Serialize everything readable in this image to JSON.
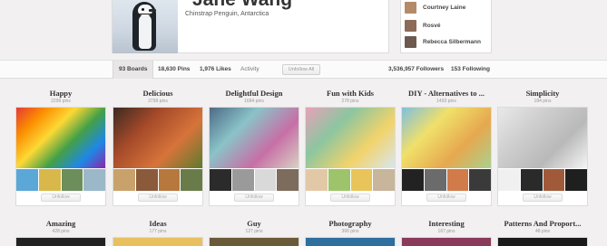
{
  "profile": {
    "name": "Jane Wang",
    "about": "Chinstrap Penguin, Antarctica"
  },
  "followers_preview": [
    {
      "name": "Courtney Laine",
      "color": "#b58a68"
    },
    {
      "name": "Rosvé",
      "color": "#8c6b58"
    },
    {
      "name": "Rebecca Silbermann",
      "color": "#6d5a4f"
    }
  ],
  "stats": {
    "boards": "93 Boards",
    "pins": "18,630 Pins",
    "likes": "1,976 Likes",
    "activity": "Activity",
    "unfollow_all": "Unfollow All",
    "followers": "3,536,957 Followers",
    "following": "153 Following"
  },
  "boards_row1": [
    {
      "title": "Happy",
      "count": "2299 pins",
      "unfollow": "Unfollow",
      "cover_colors": [
        "#e53935",
        "#fb8c00",
        "#fdd835",
        "#43a047",
        "#1e88e5",
        "#8e24aa"
      ],
      "thumb_colors": [
        "#5aa7d8",
        "#d8b84a",
        "#6b8e5a",
        "#9ab8c8"
      ]
    },
    {
      "title": "Delicious",
      "count": "3799 pins",
      "unfollow": "Unfollow",
      "cover_colors": [
        "#3b2a22",
        "#a64a2a",
        "#d6743a",
        "#5e7a2e"
      ],
      "thumb_colors": [
        "#c9a26b",
        "#8a5a3a",
        "#b7783e",
        "#6a7b4a"
      ]
    },
    {
      "title": "Delightful Design",
      "count": "1684 pins",
      "unfollow": "Unfollow",
      "cover_colors": [
        "#4d6b86",
        "#8ac3c8",
        "#c76fa6",
        "#d9d2c2"
      ],
      "thumb_colors": [
        "#2b2b2b",
        "#9a9a9a",
        "#d9d9d9",
        "#7d6b5c"
      ]
    },
    {
      "title": "Fun with Kids",
      "count": "278 pins",
      "unfollow": "Unfollow",
      "cover_colors": [
        "#e7a1b9",
        "#8cc6a0",
        "#f2d36b",
        "#d8e6ef"
      ],
      "thumb_colors": [
        "#e3c8a8",
        "#9dc46b",
        "#e8c45a",
        "#c7b59c"
      ]
    },
    {
      "title": "DIY - Alternatives to ...",
      "count": "1493 pins",
      "unfollow": "Unfollow",
      "cover_colors": [
        "#7fbfe0",
        "#f0e06a",
        "#e6a84f",
        "#a9d18e"
      ],
      "thumb_colors": [
        "#222222",
        "#6b6b6b",
        "#d17a4a",
        "#3a3a3a"
      ]
    },
    {
      "title": "Simplicity",
      "count": "184 pins",
      "unfollow": "Unfollow",
      "cover_colors": [
        "#e9e9e9",
        "#cfcfcf",
        "#b9b9b9",
        "#f5f5f5"
      ],
      "thumb_colors": [
        "#f0f0f0",
        "#2a2a2a",
        "#a05a3a",
        "#1f1f1f"
      ]
    }
  ],
  "boards_row2": [
    {
      "title": "Amazing",
      "count": "428 pins"
    },
    {
      "title": "Ideas",
      "count": "177 pins"
    },
    {
      "title": "Guy",
      "count": "127 pins"
    },
    {
      "title": "Photography",
      "count": "366 pins"
    },
    {
      "title": "Interesting",
      "count": "167 pins"
    },
    {
      "title": "Patterns And Proport...",
      "count": "48 pins"
    }
  ],
  "row2_peek_colors": [
    "#222222",
    "#e8c060",
    "#6b5a3a",
    "#2e6f9e",
    "#8a3a5a",
    "#1a1a1a"
  ]
}
